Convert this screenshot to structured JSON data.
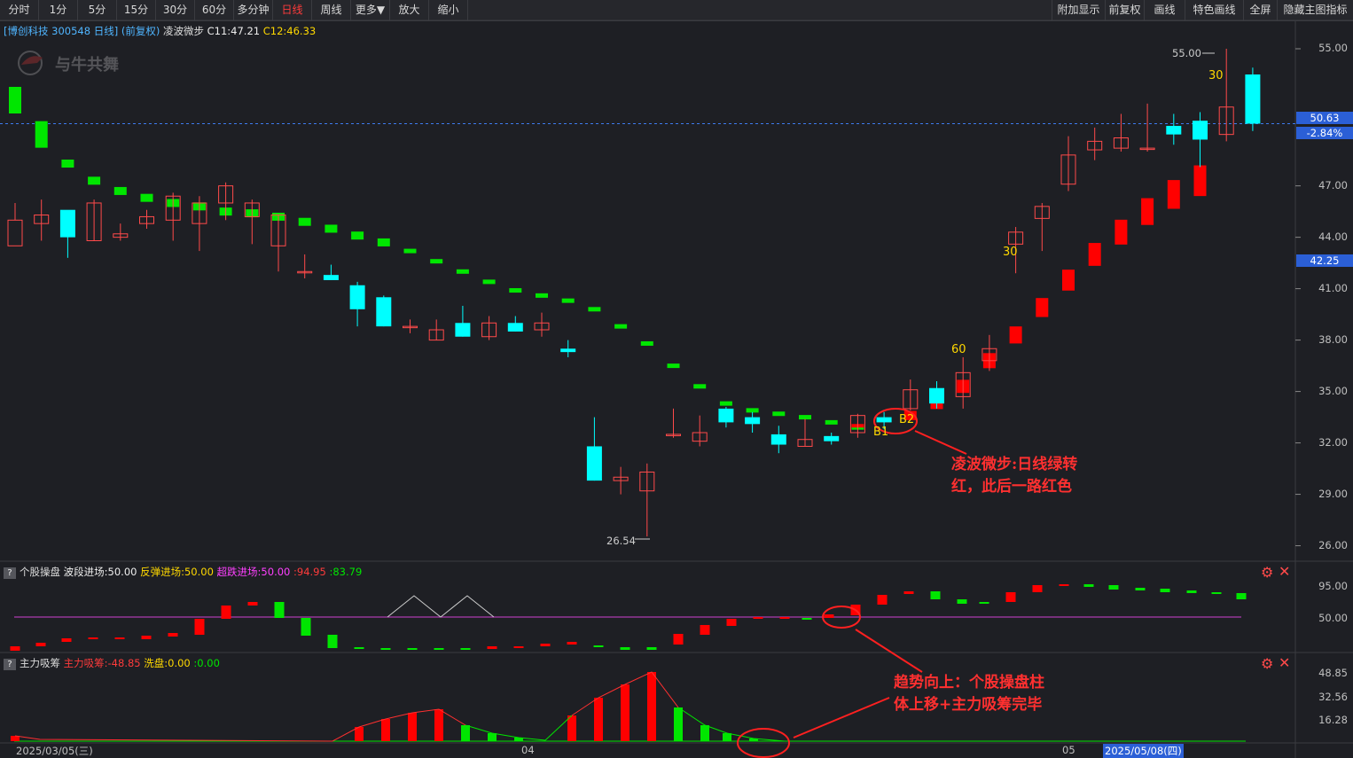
{
  "toolbar": {
    "left": [
      "分时",
      "1分",
      "5分",
      "15分",
      "30分",
      "60分",
      "多分钟",
      "日线",
      "周线",
      "更多▼",
      "放大",
      "缩小"
    ],
    "active": "日线",
    "right": [
      "附加显示",
      "前复权",
      "画线",
      "特色画线",
      "全屏",
      "隐藏主图指标"
    ]
  },
  "main_info": {
    "stock": "[博创科技 300548 日线]",
    "adjust": "(前复权)",
    "indicator": "凌波微步",
    "c1": "C11:47.21",
    "c2": "C12:46.33"
  },
  "watermark": "与牛共舞",
  "price_axis": [
    "55.00",
    "47.00",
    "44.00",
    "41.00",
    "38.00",
    "35.00",
    "32.00",
    "29.00",
    "26.00"
  ],
  "price_tags": {
    "current": "50.63",
    "change": "-2.84%",
    "cross": "42.25"
  },
  "price_labels": {
    "high": "55.00",
    "low": "26.54"
  },
  "marks": {
    "m30a": "30",
    "m30b": "30",
    "m60": "60",
    "b1": "B1",
    "b2": "B2"
  },
  "annotation1": [
    "凌波微步:日线绿转",
    "红，此后一路红色"
  ],
  "annotation2": [
    "趋势向上：个股操盘柱",
    "体上移+主力吸筹完毕"
  ],
  "panel1": {
    "title": "个股操盘",
    "v1": "波段进场:50.00",
    "v2": "反弹进场:50.00",
    "v3": "超跌进场:50.00",
    "v4": ":94.95",
    "v5": ":83.79",
    "axis": [
      "95.00",
      "50.00"
    ]
  },
  "panel2": {
    "title": "主力吸筹",
    "v1": "主力吸筹:-48.85",
    "v2": "洗盘:0.00",
    "v3": ":0.00",
    "axis": [
      "48.85",
      "32.56",
      "16.28"
    ]
  },
  "date_axis": {
    "d1": "2025/03/05(三)",
    "d2": "04",
    "d3": "05",
    "d4": "2025/05/08(四)"
  },
  "colors": {
    "up": "#ff3b3b",
    "down": "#00ffff",
    "green": "#00e600",
    "red": "#ff0000",
    "accent": "#2b5fd6"
  },
  "chart_data": {
    "type": "candlestick",
    "candles": [
      [
        43.5,
        45.0,
        46.0,
        45.0
      ],
      [
        44.8,
        45.3,
        46.2,
        43.8
      ],
      [
        45.6,
        44.0,
        45.0,
        42.8
      ],
      [
        43.8,
        46.0,
        46.2,
        43.8
      ],
      [
        44.0,
        44.2,
        44.8,
        43.8
      ],
      [
        44.8,
        45.2,
        45.6,
        44.5
      ],
      [
        45.0,
        46.4,
        46.6,
        43.8
      ],
      [
        44.8,
        46.0,
        46.4,
        43.2
      ],
      [
        46.0,
        47.0,
        47.2,
        45.0
      ],
      [
        45.2,
        46.0,
        46.2,
        43.6
      ],
      [
        43.5,
        45.3,
        45.3,
        42.0
      ],
      [
        42.0,
        42.0,
        43.0,
        41.6
      ],
      [
        41.8,
        41.5,
        42.4,
        41.5
      ],
      [
        41.2,
        39.8,
        41.4,
        38.8
      ],
      [
        40.5,
        38.8,
        40.6,
        38.8
      ],
      [
        38.8,
        38.8,
        39.2,
        38.4
      ],
      [
        38.0,
        38.6,
        39.2,
        38.0
      ],
      [
        39.0,
        38.2,
        40.0,
        38.2
      ],
      [
        38.2,
        39.0,
        39.4,
        38.0
      ],
      [
        39.0,
        38.5,
        39.4,
        38.5
      ],
      [
        38.6,
        39.0,
        39.6,
        38.2
      ],
      [
        37.5,
        37.3,
        38.0,
        37.0
      ],
      [
        31.8,
        29.8,
        33.5,
        29.8
      ],
      [
        29.8,
        30.0,
        30.6,
        29.0
      ],
      [
        29.2,
        30.3,
        30.8,
        26.54
      ],
      [
        32.5,
        32.5,
        34.0,
        32.3
      ],
      [
        32.1,
        32.6,
        33.6,
        31.8
      ],
      [
        34.0,
        33.2,
        34.1,
        32.9
      ],
      [
        33.5,
        33.1,
        33.8,
        32.6
      ],
      [
        32.5,
        31.9,
        33.0,
        31.4
      ],
      [
        31.8,
        32.2,
        33.4,
        31.8
      ],
      [
        32.4,
        32.1,
        32.6,
        31.9
      ],
      [
        32.6,
        33.6,
        33.7,
        32.3
      ],
      [
        33.5,
        33.2,
        33.8,
        32.8
      ],
      [
        34.0,
        35.1,
        35.7,
        33.9
      ],
      [
        35.2,
        34.3,
        35.6,
        34.0
      ],
      [
        34.7,
        36.1,
        37.0,
        34.0
      ],
      [
        36.8,
        37.5,
        38.3,
        36.2
      ],
      [
        43.6,
        44.3,
        44.6,
        41.9
      ],
      [
        45.1,
        45.8,
        46.0,
        43.2
      ],
      [
        47.1,
        48.8,
        49.9,
        46.7
      ],
      [
        49.1,
        49.6,
        50.4,
        48.5
      ],
      [
        49.2,
        49.8,
        51.2,
        49.0
      ],
      [
        49.2,
        49.2,
        51.8,
        49.0
      ],
      [
        50.5,
        50.0,
        51.2,
        49.4
      ],
      [
        50.8,
        49.7,
        51.3,
        48.1
      ],
      [
        50.0,
        51.6,
        55.0,
        49.6
      ],
      [
        53.5,
        50.63,
        53.9,
        50.2
      ]
    ],
    "wave_line": {
      "green": [
        52.0,
        50.0,
        48.3,
        47.3,
        46.7,
        46.3,
        46.0,
        45.8,
        45.5,
        45.4,
        45.2,
        44.9,
        44.5,
        44.1,
        43.7,
        43.2,
        42.6,
        42.0,
        41.4,
        40.9,
        40.6,
        40.3,
        39.8,
        38.8,
        37.8,
        36.5,
        35.3,
        34.3,
        33.9,
        33.7,
        33.5,
        33.2,
        32.9
      ],
      "red": [
        33.0,
        33.3,
        33.6,
        34.3,
        35.3,
        36.8,
        38.3,
        39.9,
        41.5,
        43.0,
        44.3,
        45.5,
        46.5,
        47.3
      ]
    }
  }
}
